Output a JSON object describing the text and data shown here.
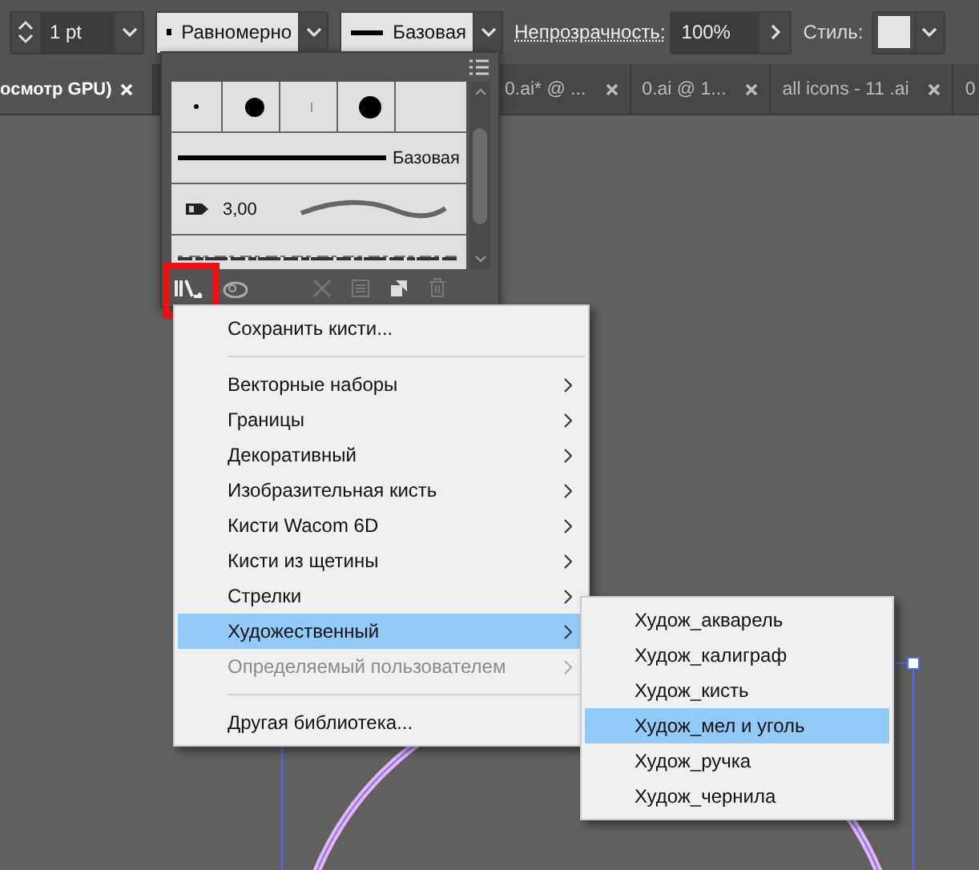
{
  "toolbar": {
    "stroke_weight": "1 pt",
    "width_profile": "Равномерно",
    "brush": "Базовая",
    "opacity_label": "Непрозрачность:",
    "opacity": "100%",
    "style_label": "Стиль:"
  },
  "tabs": [
    {
      "label": "осмотр GPU)",
      "selected": true
    },
    {
      "label": "0.ai* @ ...",
      "selected": false
    },
    {
      "label": "0.ai @ 1...",
      "selected": false
    },
    {
      "label": "all icons - 11 .ai",
      "selected": false
    },
    {
      "label": "0",
      "selected": false
    }
  ],
  "brushes_panel": {
    "rows": [
      {
        "kind": "dots"
      },
      {
        "kind": "line",
        "label": "Базовая"
      },
      {
        "kind": "calligraphic",
        "size": "3,00"
      },
      {
        "kind": "texture"
      }
    ]
  },
  "menu": {
    "items": [
      {
        "kind": "command",
        "label": "Сохранить кисти...",
        "selected": false,
        "disabled": false
      },
      {
        "kind": "separator"
      },
      {
        "kind": "submenu",
        "label": "Векторные наборы",
        "selected": false,
        "disabled": false
      },
      {
        "kind": "submenu",
        "label": "Границы",
        "selected": false,
        "disabled": false
      },
      {
        "kind": "submenu",
        "label": "Декоративный",
        "selected": false,
        "disabled": false
      },
      {
        "kind": "submenu",
        "label": "Изобразительная кисть",
        "selected": false,
        "disabled": false
      },
      {
        "kind": "submenu",
        "label": "Кисти Wacom 6D",
        "selected": false,
        "disabled": false
      },
      {
        "kind": "submenu",
        "label": "Кисти из щетины",
        "selected": false,
        "disabled": false
      },
      {
        "kind": "submenu",
        "label": "Стрелки",
        "selected": false,
        "disabled": false
      },
      {
        "kind": "submenu",
        "label": "Художественный",
        "selected": true,
        "disabled": false
      },
      {
        "kind": "submenu",
        "label": "Определяемый пользователем",
        "selected": false,
        "disabled": true
      },
      {
        "kind": "separator"
      },
      {
        "kind": "command",
        "label": "Другая библиотека...",
        "selected": false,
        "disabled": false
      }
    ]
  },
  "submenu": {
    "items": [
      {
        "kind": "command",
        "label": "Худож_акварель",
        "selected": false,
        "disabled": false
      },
      {
        "kind": "command",
        "label": "Худож_калиграф",
        "selected": false,
        "disabled": false
      },
      {
        "kind": "command",
        "label": "Худож_кисть",
        "selected": false,
        "disabled": false
      },
      {
        "kind": "command",
        "label": "Худож_мел и уголь",
        "selected": true,
        "disabled": false
      },
      {
        "kind": "command",
        "label": "Худож_ручка",
        "selected": false,
        "disabled": false
      },
      {
        "kind": "command",
        "label": "Худож_чернила",
        "selected": false,
        "disabled": false
      }
    ]
  }
}
